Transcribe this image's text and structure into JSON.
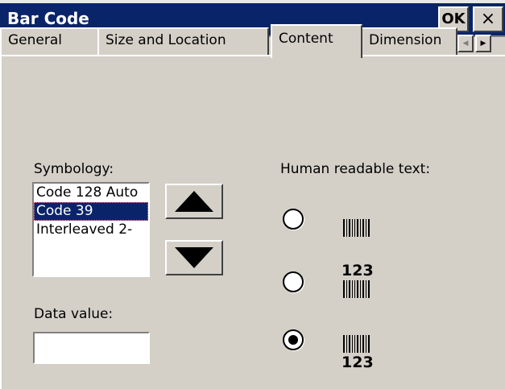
{
  "window": {
    "title": "Bar Code",
    "ok_label": "OK",
    "close_label": "×"
  },
  "tabs": [
    {
      "label": "General"
    },
    {
      "label": "Size and Location"
    },
    {
      "label": "Content"
    },
    {
      "label": "Dimension"
    }
  ],
  "active_tab": "Content",
  "tab_scroll": {
    "left_icon": "scroll-left-arrow-icon",
    "right_icon": "scroll-right-arrow-icon"
  },
  "symbology": {
    "label": "Symbology:",
    "items": [
      "Code 128 Auto",
      "Code 39",
      "Interleaved 2-"
    ],
    "selected": "Code 39"
  },
  "move_buttons": {
    "up_icon": "up-triangle-icon",
    "down_icon": "down-triangle-icon"
  },
  "data_value": {
    "label": "Data value:",
    "value": ""
  },
  "human_readable": {
    "label": "Human readable text:",
    "options": [
      {
        "icon": "barcode-only-icon",
        "text": ""
      },
      {
        "icon": "text-above-barcode-icon",
        "text": "123"
      },
      {
        "icon": "text-below-barcode-icon",
        "text": "123"
      }
    ],
    "selected_index": 2
  }
}
